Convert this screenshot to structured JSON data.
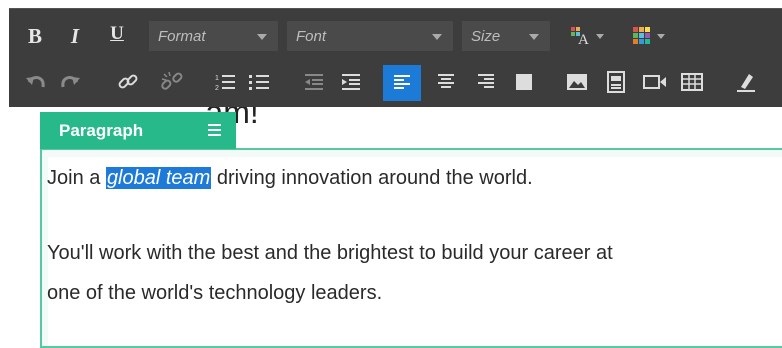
{
  "toolbar": {
    "bold_label": "B",
    "italic_label": "I",
    "underline_label": "U",
    "format_dropdown": "Format",
    "font_dropdown": "Font",
    "size_dropdown": "Size",
    "icons_row2": [
      "undo-icon",
      "redo-icon",
      "link-icon",
      "unlink-icon",
      "ordered-list-icon",
      "bullet-list-icon",
      "outdent-icon",
      "indent-icon",
      "align-left-icon",
      "align-center-icon",
      "align-right-icon",
      "justify-icon",
      "image-icon",
      "document-icon",
      "video-icon",
      "table-icon",
      "clear-format-icon"
    ],
    "active_tool": "align-left-icon",
    "active_color": "#1c7bd7"
  },
  "heading": {
    "visible_text": "am!"
  },
  "paragraph_block": {
    "label": "Paragraph",
    "accent_color": "#28b98a"
  },
  "content": {
    "p1_before": "Join a ",
    "p1_selected": "global team",
    "p1_after": " driving innovation around the world.",
    "p2_line1": "You'll work with the best and the brightest to build your career at",
    "p2_line2": "one of the world's technology leaders."
  }
}
